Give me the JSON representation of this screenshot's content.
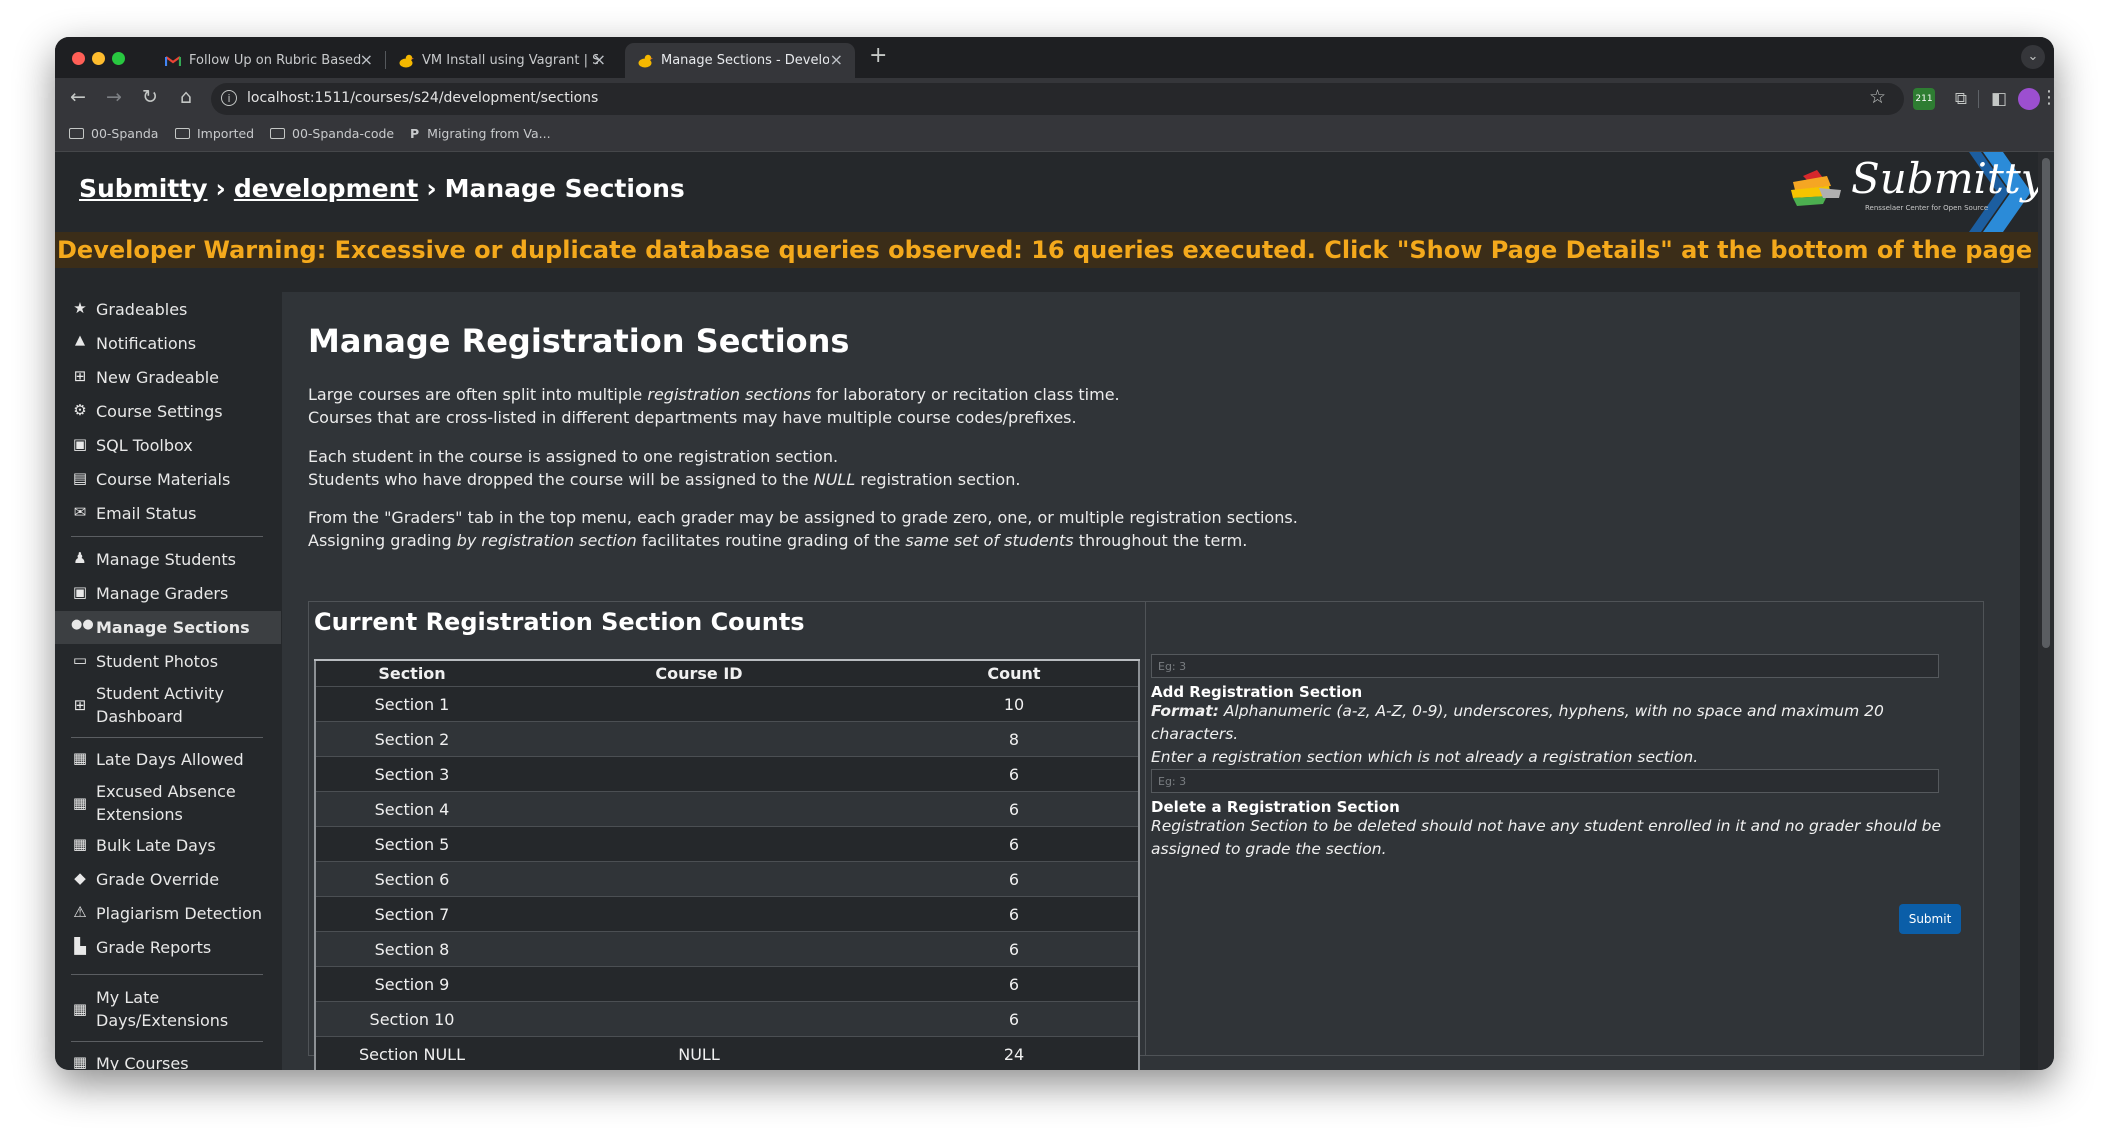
{
  "browser": {
    "tabs": [
      {
        "title": "Follow Up on Rubric Based Au",
        "favicon": "gmail-icon",
        "active": false
      },
      {
        "title": "VM Install using Vagrant | Sub",
        "favicon": "submitty-duck-icon",
        "active": false
      },
      {
        "title": "Manage Sections - Developm",
        "favicon": "submitty-duck-icon",
        "active": true
      }
    ],
    "url": "localhost:1511/courses/s24/development/sections",
    "bookmarks": [
      "00-Spanda",
      "Imported",
      "00-Spanda-code",
      "Migrating from Va..."
    ],
    "bookmark_p_letter": "P",
    "extension_badge": "211"
  },
  "header": {
    "crumb_home": "Submitty",
    "crumb_course": "development",
    "crumb_page": "Manage Sections",
    "logo_text": "Submitty",
    "logo_subtext": "Rensselaer Center for Open Source"
  },
  "dev_warning": {
    "text": "Developer Warning: Excessive or duplicate database queries observed: 16 queries executed. Click \"Show Page Details\" at the bottom of the page for more info.",
    "close": "✕"
  },
  "sidebar": {
    "items": [
      {
        "label": "Gradeables",
        "icon": "star-icon",
        "glyph": "★"
      },
      {
        "label": "Notifications",
        "icon": "bell-icon",
        "glyph": "🔔"
      },
      {
        "label": "New Gradeable",
        "icon": "plus-square-icon",
        "glyph": "⊞"
      },
      {
        "label": "Course Settings",
        "icon": "gear-icon",
        "glyph": "⚙"
      },
      {
        "label": "SQL Toolbox",
        "icon": "toolbox-icon",
        "glyph": "▣"
      },
      {
        "label": "Course Materials",
        "icon": "file-icon",
        "glyph": "▤"
      },
      {
        "label": "Email Status",
        "icon": "envelope-icon",
        "glyph": "✉"
      },
      {
        "label": "Manage Students",
        "icon": "user-graduate-icon",
        "glyph": "♟"
      },
      {
        "label": "Manage Graders",
        "icon": "id-badge-icon",
        "glyph": "▣"
      },
      {
        "label": "Manage Sections",
        "icon": "users-icon",
        "glyph": "👥"
      },
      {
        "label": "Student Photos",
        "icon": "id-card-icon",
        "glyph": "▭"
      },
      {
        "label": "Student Activity Dashboard",
        "line1": "Student Activity",
        "line2": "Dashboard",
        "icon": "table-icon",
        "glyph": "⊞"
      },
      {
        "label": "Late Days Allowed",
        "icon": "calendar-check-icon",
        "glyph": "▦"
      },
      {
        "label": "Excused Absence Extensions",
        "line1": "Excused Absence",
        "line2": "Extensions",
        "icon": "calendar-plus-icon",
        "glyph": "▦"
      },
      {
        "label": "Bulk Late Days",
        "icon": "calendar-icon",
        "glyph": "▦"
      },
      {
        "label": "Grade Override",
        "icon": "eraser-icon",
        "glyph": "◆"
      },
      {
        "label": "Plagiarism Detection",
        "icon": "warning-icon",
        "glyph": "⚠"
      },
      {
        "label": "Grade Reports",
        "icon": "chart-icon",
        "glyph": "▙"
      },
      {
        "label": "My Late Days/Extensions",
        "line1": "My Late",
        "line2": "Days/Extensions",
        "icon": "calendar-icon",
        "glyph": "▦"
      },
      {
        "label": "My Courses",
        "icon": "courses-icon",
        "glyph": "▦"
      }
    ]
  },
  "main": {
    "title": "Manage Registration Sections",
    "p1a_pre": "Large courses are often split into multiple ",
    "p1a_em": "registration sections",
    "p1a_post": " for laboratory or recitation class time.",
    "p1b": "Courses that are cross-listed in different departments may have multiple course codes/prefixes.",
    "p2a": "Each student in the course is assigned to one registration section.",
    "p2b_pre": "Students who have dropped the course will be assigned to the ",
    "p2b_em": "NULL",
    "p2b_post": " registration section.",
    "p3a": "From the \"Graders\" tab in the top menu, each grader may be assigned to grade zero, one, or multiple registration sections.",
    "p3b_pre": "Assigning grading ",
    "p3b_em1": "by registration section",
    "p3b_mid": " facilitates routine grading of the ",
    "p3b_em2": "same set of students",
    "p3b_post": " throughout the term."
  },
  "counts": {
    "title": "Current Registration Section Counts",
    "headers": [
      "Section",
      "Course ID",
      "Count"
    ],
    "rows": [
      [
        "Section 1",
        "",
        "10"
      ],
      [
        "Section 2",
        "",
        "8"
      ],
      [
        "Section 3",
        "",
        "6"
      ],
      [
        "Section 4",
        "",
        "6"
      ],
      [
        "Section 5",
        "",
        "6"
      ],
      [
        "Section 6",
        "",
        "6"
      ],
      [
        "Section 7",
        "",
        "6"
      ],
      [
        "Section 8",
        "",
        "6"
      ],
      [
        "Section 9",
        "",
        "6"
      ],
      [
        "Section 10",
        "",
        "6"
      ],
      [
        "Section NULL",
        "NULL",
        "24"
      ]
    ]
  },
  "form": {
    "add_placeholder": "Eg: 3",
    "add_label": "Add Registration Section",
    "add_format_label": "Format:",
    "add_format_text": " Alphanumeric (a-z, A-Z, 0-9), underscores, hyphens, with no space and maximum 20 characters.",
    "add_help2": "Enter a registration section which is not already a registration section.",
    "delete_placeholder": "Eg: 3",
    "delete_label": "Delete a Registration Section",
    "delete_help": "Registration Section to be deleted should not have any student enrolled in it and no grader should be assigned to grade the section.",
    "submit_label": "Submit"
  },
  "colors": {
    "warning": "#f4a91c",
    "submit": "#0b5ea8",
    "page_bg": "#25282b",
    "panel_bg": "#303438"
  }
}
